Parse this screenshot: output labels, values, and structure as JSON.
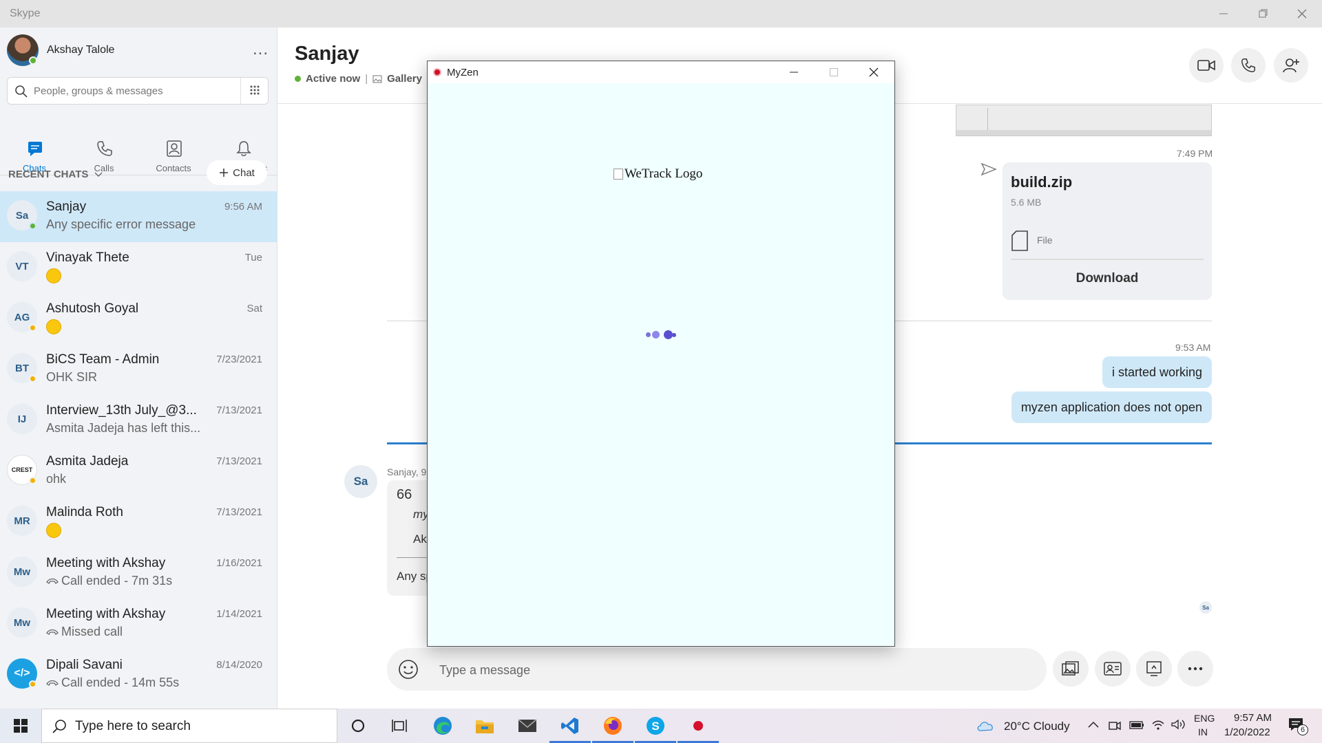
{
  "window": {
    "title": "Skype"
  },
  "profile": {
    "name": "Akshay Talole",
    "more_icon": "..."
  },
  "search": {
    "placeholder": "People, groups & messages"
  },
  "nav": {
    "chats": "Chats",
    "calls": "Calls",
    "contacts": "Contacts",
    "notifications": "Notifications"
  },
  "recent": {
    "header": "RECENT CHATS",
    "new_chat": "Chat"
  },
  "chats": [
    {
      "initials": "Sa",
      "name": "Sanjay",
      "message": "Any specific error message",
      "time": "9:56 AM",
      "status": "online"
    },
    {
      "initials": "VT",
      "name": "Vinayak Thete",
      "message": "",
      "emoji": "smile",
      "time": "Tue",
      "status": "none"
    },
    {
      "initials": "AG",
      "name": "Ashutosh Goyal",
      "message": "",
      "emoji": "thinking",
      "time": "Sat",
      "status": "away"
    },
    {
      "initials": "BT",
      "name": "BiCS Team - Admin",
      "message": "OHK SIR",
      "time": "7/23/2021",
      "status": "away"
    },
    {
      "initials": "IJ",
      "name": "Interview_13th July_@3...",
      "message": "Asmita Jadeja has left this...",
      "time": "7/13/2021",
      "status": "none"
    },
    {
      "initials": "CREST",
      "name": "Asmita Jadeja",
      "message": "ohk",
      "time": "7/13/2021",
      "status": "away"
    },
    {
      "initials": "MR",
      "name": "Malinda Roth",
      "message": "",
      "emoji": "eyeroll",
      "time": "7/13/2021",
      "status": "none"
    },
    {
      "initials": "Mw",
      "name": "Meeting with Akshay",
      "message": "Call ended - 7m 31s",
      "time": "1/16/2021",
      "status": "none"
    },
    {
      "initials": "Mw",
      "name": "Meeting with Akshay",
      "message": "Missed call",
      "time": "1/14/2021",
      "status": "none"
    },
    {
      "initials": "</>",
      "name": "Dipali Savani",
      "message": "Call ended - 14m 55s",
      "time": "8/14/2020",
      "status": "away"
    }
  ],
  "conversation": {
    "name": "Sanjay",
    "status": "Active now",
    "gallery": "Gallery",
    "file_time": "7:49 PM",
    "file": {
      "name": "build.zip",
      "size": "5.6 MB",
      "type": "File",
      "action": "Download"
    },
    "sent_time": "9:53 AM",
    "sent_messages": [
      "i started working",
      "myzen application does  not open"
    ],
    "received_meta": "Sanjay, 9",
    "quote_mark": "66",
    "quote_line1": "my",
    "quote_line2": "Ak",
    "received_text": "Any sp",
    "seen_initials": "Sa"
  },
  "composer": {
    "placeholder": "Type a message"
  },
  "popup": {
    "title": "MyZen",
    "logo_alt": "WeTrack Logo",
    "bg_color": "#f0ffff"
  },
  "taskbar": {
    "search_placeholder": "Type here to search",
    "weather": "20°C  Cloudy",
    "lang_top": "ENG",
    "lang_bottom": "IN",
    "time": "9:57 AM",
    "date": "1/20/2022",
    "notifications": "6"
  },
  "colors": {
    "accent": "#0078d4",
    "online": "#5fb336",
    "away": "#f2b100",
    "selected": "#cfe8f8"
  }
}
